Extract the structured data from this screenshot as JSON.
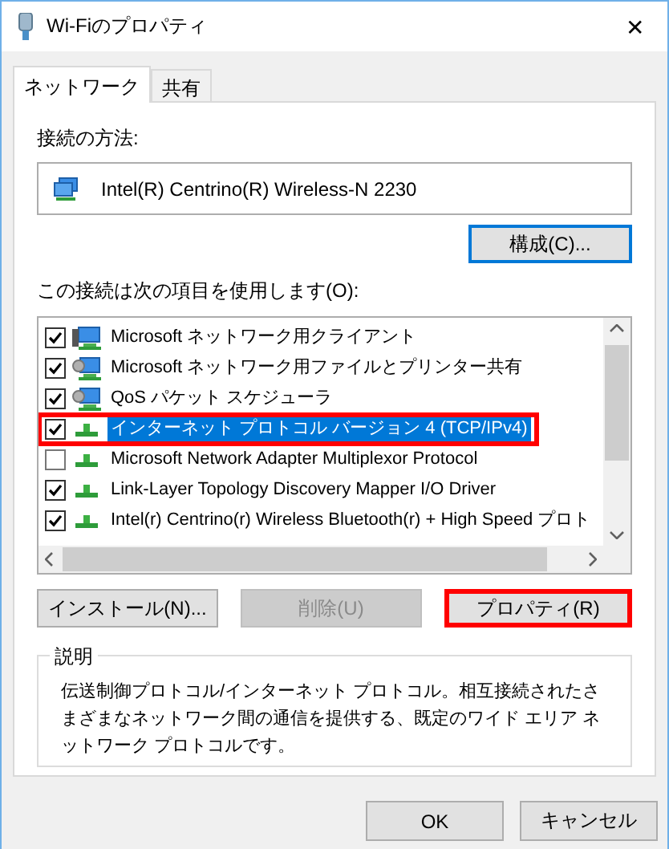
{
  "window": {
    "title": "Wi-Fiのプロパティ",
    "close": "✕"
  },
  "tabs": [
    {
      "label": "ネットワーク",
      "selected": true
    },
    {
      "label": "共有",
      "selected": false
    }
  ],
  "connect_using": {
    "label": "接続の方法:",
    "adapter": "Intel(R) Centrino(R) Wireless-N 2230",
    "configure_button": "構成(C)..."
  },
  "components": {
    "label": "この接続は次の項目を使用します(O):",
    "items": [
      {
        "kind": "client",
        "label": "Microsoft ネットワーク用クライアント",
        "checked": true,
        "selected": false,
        "highlighted": false
      },
      {
        "kind": "service",
        "label": "Microsoft ネットワーク用ファイルとプリンター共有",
        "checked": true,
        "selected": false,
        "highlighted": false
      },
      {
        "kind": "service",
        "label": "QoS パケット スケジューラ",
        "checked": true,
        "selected": false,
        "highlighted": false
      },
      {
        "kind": "protocol",
        "label": "インターネット プロトコル バージョン 4 (TCP/IPv4)",
        "checked": true,
        "selected": true,
        "highlighted": true
      },
      {
        "kind": "protocol",
        "label": "Microsoft Network Adapter Multiplexor Protocol",
        "checked": false,
        "selected": false,
        "highlighted": false
      },
      {
        "kind": "protocol",
        "label": "Link-Layer Topology Discovery Mapper I/O Driver",
        "checked": true,
        "selected": false,
        "highlighted": false
      },
      {
        "kind": "protocol",
        "label": "Intel(r) Centrino(r) Wireless Bluetooth(r) + High Speed プロト",
        "checked": true,
        "selected": false,
        "highlighted": false
      }
    ]
  },
  "buttons": [
    {
      "label": "インストール(N)...",
      "disabled": false,
      "highlighted": false
    },
    {
      "label": "削除(U)",
      "disabled": true,
      "highlighted": false
    },
    {
      "label": "プロパティ(R)",
      "disabled": false,
      "highlighted": true
    }
  ],
  "description": {
    "title": "説明",
    "text": "伝送制御プロトコル/インターネット プロトコル。相互接続されたさまざまなネットワーク間の通信を提供する、既定のワイド エリア ネットワーク プロトコルです。"
  },
  "dialog_buttons": [
    "OK",
    "キャンセル"
  ]
}
